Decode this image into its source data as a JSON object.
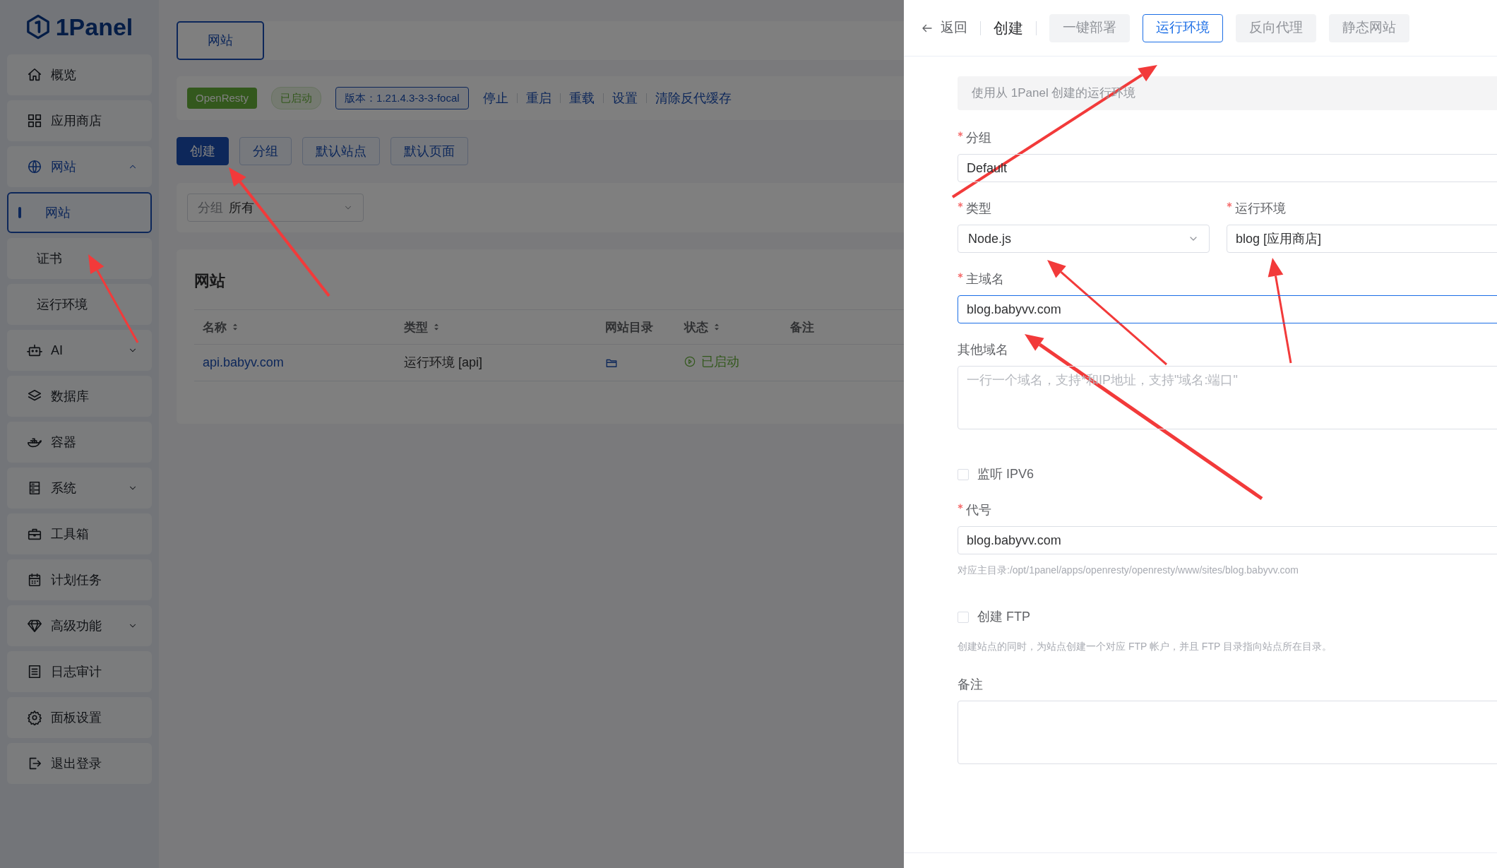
{
  "sidebar": {
    "logo": "1Panel",
    "items": [
      {
        "label": "概览",
        "selected": false
      },
      {
        "label": "应用商店",
        "selected": false
      },
      {
        "label": "网站",
        "selected": true,
        "expanded": true,
        "children": [
          {
            "label": "网站",
            "selected": true
          },
          {
            "label": "证书",
            "selected": false
          },
          {
            "label": "运行环境",
            "selected": false
          }
        ]
      },
      {
        "label": "AI",
        "selected": false,
        "expanded": false
      },
      {
        "label": "数据库",
        "selected": false
      },
      {
        "label": "容器",
        "selected": false
      },
      {
        "label": "系统",
        "selected": false,
        "expanded": false
      },
      {
        "label": "工具箱",
        "selected": false
      },
      {
        "label": "计划任务",
        "selected": false
      },
      {
        "label": "高级功能",
        "selected": false,
        "expanded": false
      },
      {
        "label": "日志审计",
        "selected": false
      },
      {
        "label": "面板设置",
        "selected": false
      },
      {
        "label": "退出登录",
        "selected": false
      }
    ]
  },
  "page_tabs": [
    {
      "label": "网站",
      "selected": true
    }
  ],
  "server_bar": {
    "app": "OpenResty",
    "status": "已启动",
    "version": "版本：1.21.4.3-3-3-focal",
    "actions": [
      "停止",
      "重启",
      "重载",
      "设置",
      "清除反代缓存"
    ]
  },
  "toolbar": [
    {
      "label": "创建",
      "kind": "primary"
    },
    {
      "label": "分组",
      "kind": "plain"
    },
    {
      "label": "默认站点",
      "kind": "plain"
    },
    {
      "label": "默认页面",
      "kind": "plain"
    }
  ],
  "filter": {
    "label": "分组",
    "value": "所有"
  },
  "table": {
    "title": "网站",
    "columns": [
      {
        "label": "名称",
        "sortable": true
      },
      {
        "label": "类型",
        "sortable": true
      },
      {
        "label": "网站目录",
        "sortable": false
      },
      {
        "label": "状态",
        "sortable": true
      },
      {
        "label": "备注",
        "sortable": false
      }
    ],
    "rows": [
      {
        "name": "api.babyv.com",
        "type": "运行环境 [api]",
        "status": "已启动"
      }
    ]
  },
  "drawer": {
    "back": "返回",
    "title": "创建",
    "tabs": [
      {
        "label": "一键部署",
        "selected": false
      },
      {
        "label": "运行环境",
        "selected": true
      },
      {
        "label": "反向代理",
        "selected": false
      },
      {
        "label": "静态网站",
        "selected": false
      }
    ],
    "notice": "使用从 1Panel 创建的运行环境",
    "fields": [
      {
        "kind": "input",
        "label": "分组",
        "required": true,
        "value": "Default"
      },
      {
        "kind": "pair",
        "items": [
          {
            "kind": "select",
            "label": "类型",
            "required": true,
            "value": "Node.js"
          },
          {
            "kind": "input",
            "label": "运行环境",
            "required": true,
            "value": "blog [应用商店]"
          }
        ]
      },
      {
        "kind": "input",
        "label": "主域名",
        "required": true,
        "value": "blog.babyvv.com",
        "focused": true
      },
      {
        "kind": "textarea",
        "label": "其他域名",
        "required": false,
        "placeholder": "一行一个域名，支持*和IP地址，支持\"域名:端口\""
      },
      {
        "kind": "checkbox",
        "label": "监听 IPV6",
        "checked": false
      },
      {
        "kind": "input",
        "label": "代号",
        "required": true,
        "value": "blog.babyvv.com",
        "hint": "对应主目录:/opt/1panel/apps/openresty/openresty/www/sites/blog.babyvv.com"
      },
      {
        "kind": "checkbox",
        "label": "创建 FTP",
        "checked": false,
        "hint": "创建站点的同时，为站点创建一个对应 FTP 帐户，并且 FTP 目录指向站点所在目录。"
      },
      {
        "kind": "textarea",
        "label": "备注",
        "required": false
      }
    ]
  }
}
